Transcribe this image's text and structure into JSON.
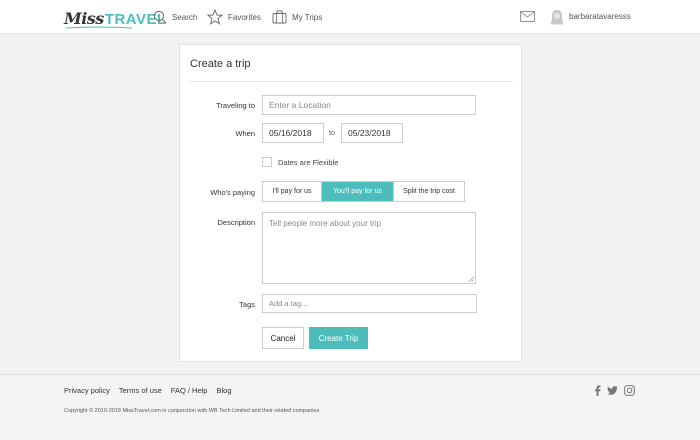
{
  "header": {
    "logo_miss": "Miss",
    "logo_travel": "TRAVEL",
    "nav_search": "Search",
    "nav_favorites": "Favorites",
    "nav_trips": "My Trips",
    "username": "barbaratavaresss"
  },
  "form": {
    "title": "Create a trip",
    "traveling_label": "Traveling to",
    "location_placeholder": "Enter a Location",
    "when_label": "When",
    "start_date": "05/16/2018",
    "to_text": "to",
    "end_date": "05/23/2018",
    "flexible_label": "Dates are Flexible",
    "flexible_checked": false,
    "whos_paying_label": "Who's paying",
    "paying_options": [
      "I'll pay for us",
      "You'll pay for us",
      "Split the trip cost"
    ],
    "paying_selected": "You'll pay for us",
    "description_label": "Description",
    "description_placeholder": "Tell people more about your trip",
    "tags_label": "Tags",
    "tags_placeholder": "Add a tag...",
    "cancel_label": "Cancel",
    "create_label": "Create Trip"
  },
  "footer": {
    "links": [
      "Privacy policy",
      "Terms of use",
      "FAQ / Help",
      "Blog"
    ],
    "social_icons": [
      "facebook-icon",
      "twitter-icon",
      "instagram-icon"
    ],
    "copyright": "Copyright © 2010-2018 MissTravel.com in conjunction with WB Tech Limited and their related companies"
  },
  "colors": {
    "accent": "#4cbdbb",
    "background": "#f2f2f2",
    "card": "#ffffff"
  }
}
